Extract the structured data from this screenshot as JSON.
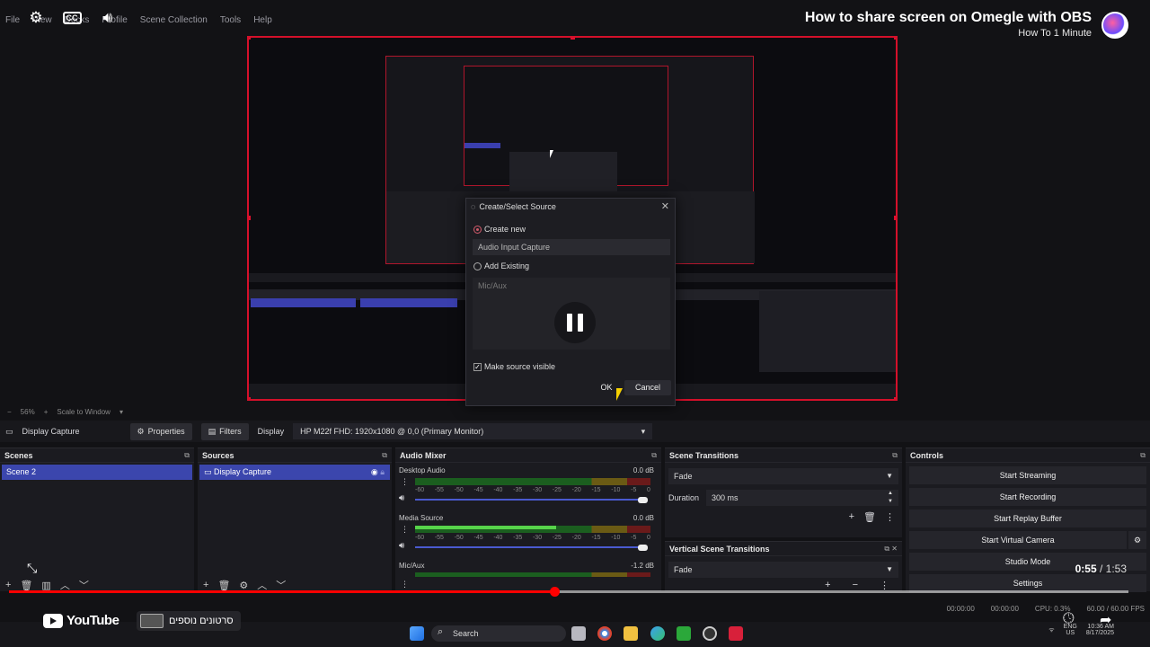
{
  "menu": [
    "File",
    "View",
    "Docks",
    "Profile",
    "Scene Collection",
    "Tools",
    "Help"
  ],
  "video": {
    "title": "How to share screen on Omegle with OBS",
    "channel": "How To 1 Minute",
    "current_time": "0:55",
    "total_time": "1:53",
    "progress_fraction": 0.487,
    "more_videos": "סרטונים נוספים",
    "logo_text": "YouTube"
  },
  "dialog": {
    "title": "Create/Select Source",
    "create_new": "Create new",
    "new_name": "Audio Input Capture",
    "add_existing": "Add Existing",
    "existing_item": "Mic/Aux",
    "visible_label": "Make source visible",
    "ok": "OK",
    "cancel": "Cancel"
  },
  "preview_bar": {
    "zoom": "56%",
    "scale": "Scale to Window"
  },
  "toolbar": {
    "source_name": "Display Capture",
    "properties": "Properties",
    "filters": "Filters",
    "display_label": "Display",
    "display_value": "HP M22f FHD: 1920x1080 @ 0,0 (Primary Monitor)"
  },
  "scenes": {
    "title": "Scenes",
    "items": [
      "Scene 2"
    ]
  },
  "sources": {
    "title": "Sources",
    "items": [
      "Display Capture"
    ]
  },
  "mixer": {
    "title": "Audio Mixer",
    "scale": [
      "-60",
      "-55",
      "-50",
      "-45",
      "-40",
      "-35",
      "-30",
      "-25",
      "-20",
      "-15",
      "-10",
      "-5",
      "0"
    ],
    "channels": [
      {
        "name": "Desktop Audio",
        "db": "0.0 dB",
        "level": 0.0
      },
      {
        "name": "Media Source",
        "db": "0.0 dB",
        "level": 0.6
      },
      {
        "name": "Mic/Aux",
        "db": "-1.2 dB",
        "level": 0.0
      }
    ]
  },
  "transitions": {
    "title": "Scene Transitions",
    "value": "Fade",
    "duration_label": "Duration",
    "duration": "300 ms"
  },
  "vertical": {
    "title": "Vertical Scene Transitions",
    "value": "Fade"
  },
  "controls": {
    "title": "Controls",
    "buttons": [
      "Start Streaming",
      "Start Recording",
      "Start Replay Buffer",
      "Start Virtual Camera",
      "Studio Mode",
      "Settings"
    ]
  },
  "status": {
    "stream_time": "00:00:00",
    "rec_time": "00:00:00",
    "cpu": "CPU: 0.3%",
    "fps": "60.00 / 60.00 FPS"
  },
  "taskbar": {
    "search": "Search",
    "lang": "ENG",
    "region": "US",
    "clock": "10:36 AM",
    "date": "8/17/2025"
  },
  "colors": {
    "accent_red": "#ff0000",
    "scene_selected": "#3b46ad",
    "meter_green": "#57d44a"
  }
}
